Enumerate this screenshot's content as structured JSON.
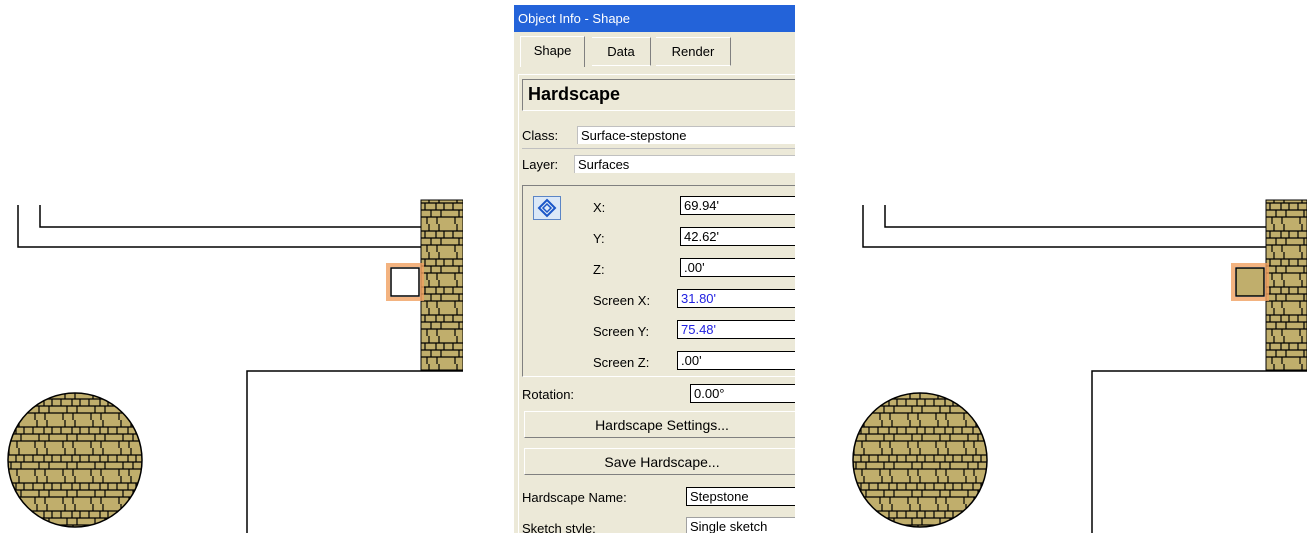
{
  "palette": {
    "title": "Object Info - Shape",
    "tabs": [
      {
        "label": "Shape",
        "active": true
      },
      {
        "label": "Data",
        "active": false
      },
      {
        "label": "Render",
        "active": false
      }
    ],
    "object_type": "Hardscape",
    "class": {
      "label": "Class:",
      "value": "Surface-stepstone"
    },
    "layer": {
      "label": "Layer:",
      "value": "Surfaces"
    },
    "coords": {
      "icon": "alignment-point-icon",
      "x": {
        "label": "X:",
        "value": "69.94'"
      },
      "y": {
        "label": "Y:",
        "value": "42.62'"
      },
      "z": {
        "label": "Z:",
        "value": ".00'"
      },
      "screen_x": {
        "label": "Screen X:",
        "value": "31.80'"
      },
      "screen_y": {
        "label": "Screen Y:",
        "value": "75.48'"
      },
      "screen_z": {
        "label": "Screen Z:",
        "value": ".00'"
      }
    },
    "rotation": {
      "label": "Rotation:",
      "value": "0.00°"
    },
    "buttons": {
      "settings": "Hardscape Settings...",
      "save": "Save Hardscape..."
    },
    "hardscape_name": {
      "label": "Hardscape Name:",
      "value": "Stepstone"
    },
    "sketch_style": {
      "label": "Sketch style:",
      "value": "Single sketch"
    }
  },
  "colors": {
    "stone_fill": "#c0ae6c",
    "selection_highlight": "#f0a060",
    "title_bar": "#2363d9"
  }
}
